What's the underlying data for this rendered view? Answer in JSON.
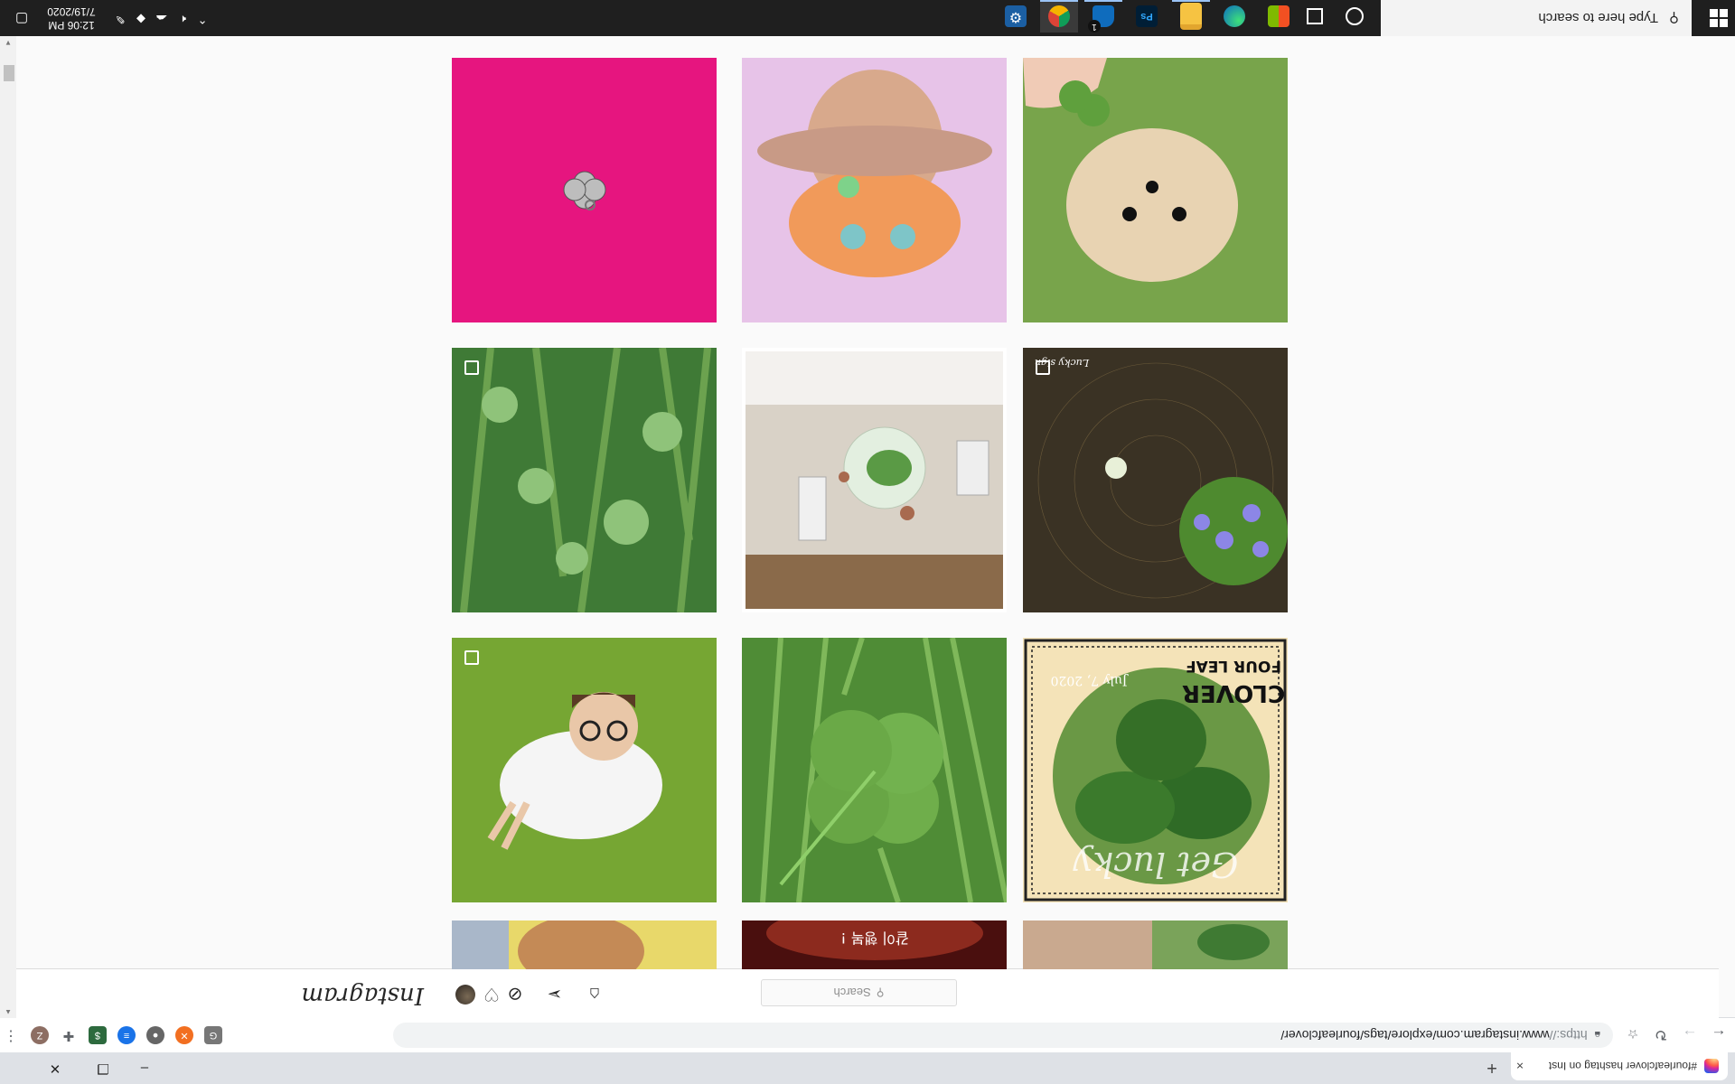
{
  "browser": {
    "tab_title": "#fourleafclover hashtag on Inst",
    "tab_close": "×",
    "new_tab": "+",
    "url_scheme": "https://",
    "url_rest": "www.instagram.com/explore/tags/fourleafclover/",
    "back": "←",
    "forward": "→",
    "reload": "↻",
    "window_minimize": "–",
    "window_restore": "❐",
    "window_close": "✕",
    "profile_initial": "Z",
    "menu": "⋮"
  },
  "instagram": {
    "logo": "Instagram",
    "search_placeholder": "Search",
    "search_icon": "⚲",
    "nav_icons": [
      "home-icon",
      "direct-icon",
      "explore-icon",
      "activity-icon",
      "profile-avatar"
    ]
  },
  "posts": [
    {
      "desc": "silver clover charm",
      "bg": "#e6157f",
      "multi": false
    },
    {
      "desc": "illustration",
      "bg": "#e7c3e8",
      "multi": false
    },
    {
      "desc": "pomeranian dog",
      "bg": "#6f9a43",
      "multi": false
    },
    {
      "desc": "clover patch",
      "bg": "#3f7a36",
      "multi": true
    },
    {
      "desc": "terrarium supplies",
      "bg": "#d9d2c7",
      "multi": false
    },
    {
      "desc": "spider web clover",
      "bg": "#3a3224",
      "multi": true
    },
    {
      "desc": "person on grass",
      "bg": "#6c9a2c",
      "multi": true
    },
    {
      "desc": "four leaf clover",
      "bg": "#4f8c36",
      "multi": false
    },
    {
      "desc": "card",
      "bg": "#e9d7a9",
      "multi": false
    },
    {
      "desc": "partial",
      "bg": "#e8d86a",
      "multi": false
    },
    {
      "desc": "partial",
      "bg": "#6d1c18",
      "multi": false
    },
    {
      "desc": "partial",
      "bg": "#7aa35a",
      "multi": false
    }
  ],
  "post_texts": {
    "watermark": "Lucky sign",
    "card_title_1": "FOUR LEAF",
    "card_title_2": "CLOVER",
    "card_date": "July 7, 2020",
    "card_script": "Get lucky",
    "partial_korean": "같이 행복 !"
  },
  "taskbar": {
    "search_placeholder": "Type here to search",
    "search_icon": "⚲",
    "time": "12:06 PM",
    "date": "7/19/2020",
    "apps": [
      "cortana-icon",
      "task-view-icon",
      "store-icon",
      "edge-icon",
      "file-explorer-icon",
      "photoshop-icon",
      "onedrive-icon",
      "chrome-icon",
      "settings-icon"
    ],
    "photoshop_label": "Ps",
    "notification_badge": "1"
  },
  "colors": {
    "instagram_bg": "#fafafa",
    "taskbar": "#1f1f1f",
    "tabstrip": "#dee1e6"
  }
}
